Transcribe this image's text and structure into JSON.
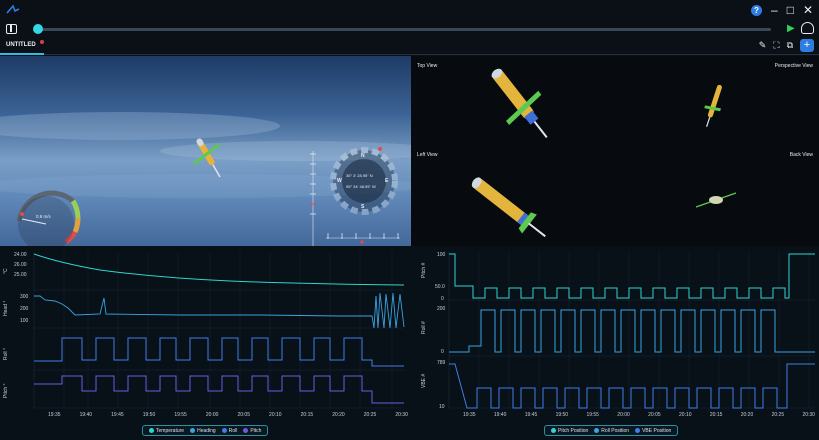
{
  "window": {
    "help_label": "?",
    "minimize_label": "–",
    "maximize_label": "□",
    "close_label": "✕"
  },
  "tabs": [
    {
      "label": "UNTITLED"
    }
  ],
  "views": {
    "top": "Top View",
    "perspective": "Perspective View",
    "left": "Left View",
    "back": "Back View"
  },
  "hud": {
    "airspeed": "0.8 m/s",
    "compass": {
      "n": "N",
      "e": "E",
      "s": "S",
      "w": "W",
      "line1": "36° 3' 28.95\" N",
      "line2": "95° 34' 48.95\" W"
    }
  },
  "chart_left": {
    "ylabels": [
      "°C",
      "Head °",
      "Roll °",
      "Pitch °"
    ],
    "yticks_temp": [
      "24.00",
      "26.00",
      "25.00"
    ],
    "yticks_head": [
      "300",
      "200",
      "100"
    ],
    "xticks": [
      "19:35",
      "19:40",
      "19:45",
      "19:50",
      "19:55",
      "20:00",
      "20:05",
      "20:10",
      "20:15",
      "20:20",
      "20:25",
      "20:30"
    ],
    "legend": [
      "Temperature",
      "Heading",
      "Roll",
      "Pitch"
    ]
  },
  "chart_right": {
    "ylabels": [
      "Pitch #",
      "Roll #",
      "VBE #"
    ],
    "yticks_pitch": [
      "100",
      "50.0",
      "0"
    ],
    "yticks_roll": [
      "200",
      "0"
    ],
    "yticks_vbe": [
      "789",
      "10"
    ],
    "xticks": [
      "19:35",
      "19:40",
      "19:45",
      "19:50",
      "19:55",
      "20:00",
      "20:05",
      "20:10",
      "20:15",
      "20:20",
      "20:25",
      "20:30"
    ],
    "legend": [
      "Pitch Position",
      "Roll Position",
      "VBE Position"
    ]
  },
  "colors": {
    "accent": "#35d7e7",
    "temperature": "#2fd5d0",
    "heading": "#3aa3e0",
    "roll": "#3f7ee8",
    "pitch": "#6b5be0",
    "add": "#2f7de1"
  }
}
